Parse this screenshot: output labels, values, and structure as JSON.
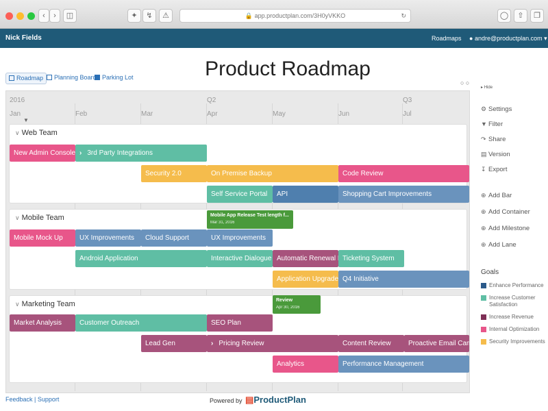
{
  "browser": {
    "url": "app.productplan.com/3H0yVKKO",
    "dots": [
      "#fc5f57",
      "#fdbc2e",
      "#29c840"
    ]
  },
  "header": {
    "user": "Nick Fields",
    "roadmaps": "Roadmaps",
    "email": "andre@productplan.com"
  },
  "views": {
    "roadmap": "Roadmap",
    "planning_board": "Planning Board",
    "parking_lot": "Parking Lot"
  },
  "page_title": "Product Roadmap",
  "zoom_glyph": "○ ○",
  "timeline": {
    "year_2016": "2016",
    "q2": "Q2",
    "q3": "Q3",
    "months": [
      "Jan",
      "Feb",
      "Mar",
      "Apr",
      "May",
      "Jun",
      "Jul"
    ]
  },
  "lanes": [
    {
      "title": "Web Team"
    },
    {
      "title": "Mobile Team"
    },
    {
      "title": "Marketing Team"
    }
  ],
  "bars": [
    {
      "label": "New Admin Console",
      "color": "#e8568a",
      "goal": "Increase Customer Satisfaction"
    },
    {
      "label": "3rd Party Integrations",
      "color": "#5fbea4",
      "arrow": true,
      "goal": "Increase Customer Satisfaction"
    },
    {
      "label": "Security 2.0",
      "color": "#f5bc4c",
      "goal": "Security Improvements"
    },
    {
      "label": "On Premise Backup",
      "color": "#f5bc4c",
      "goal": "Security Improvements"
    },
    {
      "label": "Code Review",
      "color": "#e8568a",
      "goal": "Internal Optimization"
    },
    {
      "label": "Self Service Portal",
      "color": "#5fbea4",
      "goal": "Increase Customer Satisfaction"
    },
    {
      "label": "API",
      "color": "#4f7fae",
      "goal": "Enhance Performance"
    },
    {
      "label": "Shopping Cart Improvements",
      "color": "#6a93bd",
      "goal": "Enhance Performance"
    },
    {
      "label": "Mobile Mock Up",
      "color": "#e8568a",
      "goal": "Internal Optimization"
    },
    {
      "label": "UX Improvements",
      "color": "#6a93bd",
      "goal": "Enhance Performance"
    },
    {
      "label": "Cloud Support",
      "color": "#6a93bd",
      "goal": "Enhance Performance"
    },
    {
      "label": "UX Improvements",
      "color": "#6a93bd",
      "goal": "Enhance Performance"
    },
    {
      "label": "Android Application",
      "color": "#5fbea4",
      "goal": "Increase Customer Satisfaction"
    },
    {
      "label": "Interactive Dialogue",
      "color": "#5fbea4",
      "goal": "Increase Customer Satisfaction"
    },
    {
      "label": "Automatic Renewal E",
      "color": "#a7537c",
      "goal": "Increase Revenue"
    },
    {
      "label": "Ticketing System",
      "color": "#5fbea4",
      "goal": "Increase Customer Satisfaction"
    },
    {
      "label": "Application Upgrade",
      "color": "#f5bc4c",
      "goal": "Security Improvements"
    },
    {
      "label": "Q4 Initiative",
      "color": "#6a93bd",
      "goal": "Enhance Performance"
    },
    {
      "label": "Market Analysis",
      "color": "#a7537c",
      "goal": "Increase Revenue"
    },
    {
      "label": "Customer Outreach",
      "color": "#5fbea4",
      "goal": "Increase Customer Satisfaction"
    },
    {
      "label": "SEO Plan",
      "color": "#a7537c",
      "goal": "Increase Revenue"
    },
    {
      "label": "Lead Gen",
      "color": "#a7537c",
      "goal": "Increase Revenue"
    },
    {
      "label": "Pricing Review",
      "color": "#a7537c",
      "arrow": true,
      "goal": "Increase Revenue"
    },
    {
      "label": "Content Review",
      "color": "#a7537c",
      "goal": "Increase Revenue"
    },
    {
      "label": "Proactive Email Camp",
      "color": "#a7537c",
      "goal": "Increase Revenue"
    },
    {
      "label": "Analytics",
      "color": "#e8568a",
      "goal": "Internal Optimization"
    },
    {
      "label": "Performance Management",
      "color": "#6a93bd",
      "goal": "Enhance Performance"
    }
  ],
  "milestones": [
    {
      "title": "Mobile App Release Test length f...",
      "date": "Mar 31, 2016"
    },
    {
      "title": "Review",
      "date": "Apr 30, 2016"
    }
  ],
  "menu": {
    "hide": "Hide",
    "settings": "Settings",
    "filter": "Filter",
    "share": "Share",
    "version": "Version",
    "export": "Export",
    "add_bar": "Add Bar",
    "add_container": "Add Container",
    "add_milestone": "Add Milestone",
    "add_lane": "Add Lane"
  },
  "goals": {
    "title": "Goals",
    "items": [
      {
        "label": "Enhance Performance",
        "color": "#2b5a8a"
      },
      {
        "label": "Increase Customer Satisfaction",
        "color": "#5fbea4"
      },
      {
        "label": "Increase Revenue",
        "color": "#7e2f56"
      },
      {
        "label": "Internal Optimization",
        "color": "#e8568a"
      },
      {
        "label": "Security Improvements",
        "color": "#f5bc4c"
      }
    ]
  },
  "footer": {
    "feedback": "Feedback",
    "support": "Support",
    "powered_by": "Powered by",
    "brand": "ProductPlan"
  }
}
